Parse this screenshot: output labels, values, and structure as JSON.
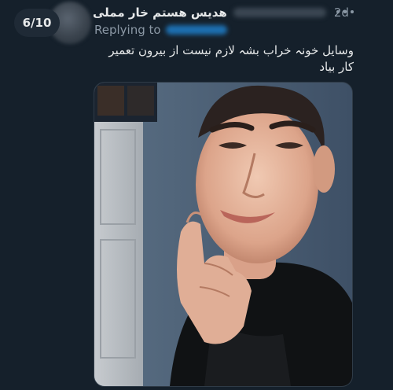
{
  "counter": "6/10",
  "tweet": {
    "display_name": "هدیس هستم خار مملی",
    "timestamp": "2d",
    "replying_label": "Replying to",
    "text": "وسایل خونہ خراب بشہ لازم نیست از بیرون تعمیر کار بیاد",
    "more_icon": "more-horizontal-icon"
  },
  "colors": {
    "background": "#15202b",
    "text": "#e7e9ea",
    "muted": "#8b98a5",
    "link": "#1d9bf0"
  }
}
